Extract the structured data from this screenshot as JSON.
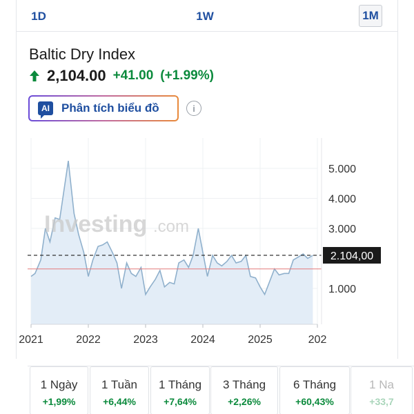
{
  "periods": [
    {
      "label": "1D",
      "active": false
    },
    {
      "label": "1W",
      "active": false
    },
    {
      "label": "1M",
      "active": true
    }
  ],
  "instrument": {
    "name": "Baltic Dry Index",
    "price": "2,104.00",
    "change": "+41.00",
    "change_pct": "(+1.99%)",
    "direction": "up"
  },
  "ai_button": {
    "badge": "AI",
    "label": "Phân tích biểu đồ"
  },
  "watermark": {
    "brand": "Investing",
    "suffix": ".com"
  },
  "colors": {
    "positive": "#0b8a3c",
    "accent": "#1f4fa0",
    "line": "#8fb0cc",
    "fill": "#e3edf7",
    "reference_line": "#e47a7a"
  },
  "chart_data": {
    "type": "area",
    "x_axis_labels": [
      "2021",
      "2022",
      "2023",
      "2024",
      "2025",
      "202"
    ],
    "y_ticks": [
      1000,
      3000,
      4000,
      5000
    ],
    "y_tick_labels": [
      "1.000",
      "3.000",
      "4.000",
      "5.000"
    ],
    "last_value": 2104,
    "last_value_label": "2.104,00",
    "reference_value": 1650,
    "ylim": [
      0,
      5600
    ],
    "x_range": [
      2021.0,
      2026.0
    ],
    "grid": true,
    "points": [
      [
        2021.0,
        1400
      ],
      [
        2021.07,
        1500
      ],
      [
        2021.17,
        1950
      ],
      [
        2021.25,
        3000
      ],
      [
        2021.33,
        2550
      ],
      [
        2021.42,
        3350
      ],
      [
        2021.5,
        3300
      ],
      [
        2021.65,
        5250
      ],
      [
        2021.75,
        3500
      ],
      [
        2021.83,
        2800
      ],
      [
        2021.92,
        2200
      ],
      [
        2022.0,
        1400
      ],
      [
        2022.08,
        1950
      ],
      [
        2022.17,
        2400
      ],
      [
        2022.25,
        2450
      ],
      [
        2022.33,
        2550
      ],
      [
        2022.42,
        2200
      ],
      [
        2022.5,
        1850
      ],
      [
        2022.58,
        1000
      ],
      [
        2022.67,
        1850
      ],
      [
        2022.75,
        1500
      ],
      [
        2022.83,
        1400
      ],
      [
        2022.92,
        1700
      ],
      [
        2023.0,
        800
      ],
      [
        2023.08,
        1050
      ],
      [
        2023.17,
        1300
      ],
      [
        2023.25,
        1600
      ],
      [
        2023.33,
        1050
      ],
      [
        2023.42,
        1200
      ],
      [
        2023.5,
        1150
      ],
      [
        2023.58,
        1850
      ],
      [
        2023.67,
        1950
      ],
      [
        2023.75,
        1700
      ],
      [
        2023.83,
        2100
      ],
      [
        2023.92,
        3000
      ],
      [
        2024.0,
        2200
      ],
      [
        2024.08,
        1400
      ],
      [
        2024.17,
        2100
      ],
      [
        2024.25,
        1850
      ],
      [
        2024.33,
        1750
      ],
      [
        2024.42,
        1900
      ],
      [
        2024.5,
        2100
      ],
      [
        2024.58,
        1850
      ],
      [
        2024.67,
        1900
      ],
      [
        2024.75,
        2100
      ],
      [
        2024.83,
        1400
      ],
      [
        2024.92,
        1350
      ],
      [
        2025.0,
        1050
      ],
      [
        2025.08,
        800
      ],
      [
        2025.17,
        1250
      ],
      [
        2025.25,
        1650
      ],
      [
        2025.33,
        1450
      ],
      [
        2025.42,
        1500
      ],
      [
        2025.5,
        1500
      ],
      [
        2025.58,
        1950
      ],
      [
        2025.67,
        2050
      ],
      [
        2025.75,
        2150
      ],
      [
        2025.83,
        2000
      ],
      [
        2025.92,
        2104
      ]
    ]
  },
  "performance": [
    {
      "label": "1 Ngày",
      "value": "+1,99%"
    },
    {
      "label": "1 Tuần",
      "value": "+6,44%"
    },
    {
      "label": "1 Tháng",
      "value": "+7,64%"
    },
    {
      "label": "3 Tháng",
      "value": "+2,26%"
    },
    {
      "label": "6 Tháng",
      "value": "+60,43%"
    },
    {
      "label": "1 Na",
      "value": "+33,7"
    }
  ]
}
